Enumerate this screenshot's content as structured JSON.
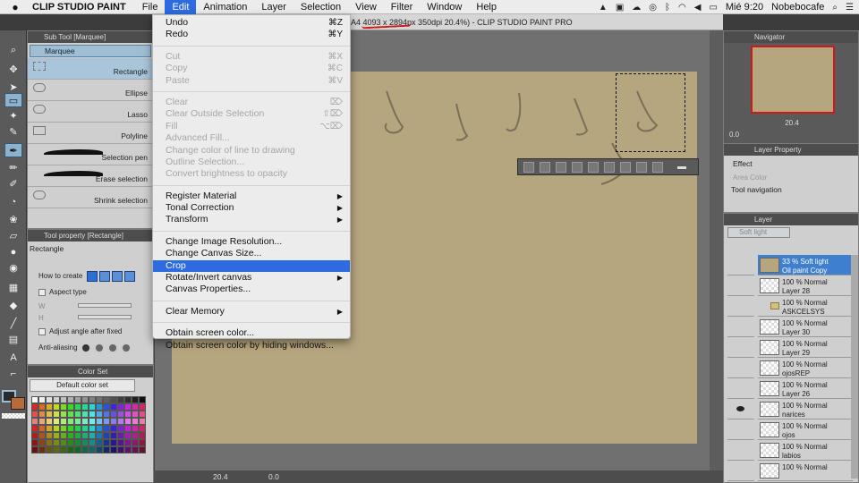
{
  "menubar": {
    "apple": "",
    "app": "CLIP STUDIO PAINT",
    "menus": [
      "File",
      "Edit",
      "Animation",
      "Layer",
      "Selection",
      "View",
      "Filter",
      "Window",
      "Help"
    ],
    "active_menu": "Edit",
    "clock": "Mié 9:20",
    "user": "Nobebocafe"
  },
  "window": {
    "title": "A4 4093 x 2894px 350dpi 20.4%) - CLIP STUDIO PAINT PRO"
  },
  "subtool": {
    "title": "Sub Tool [Marquee]",
    "tab": "Marquee",
    "items": [
      "Rectangle",
      "Ellipse",
      "Lasso",
      "Polyline",
      "Selection pen",
      "Erase selection",
      "Shrink selection"
    ]
  },
  "toolprop": {
    "title": "Tool property [Rectangle]",
    "name": "Rectangle",
    "how_to_create": "How to create",
    "aspect_type": "Aspect type",
    "w": "W",
    "h": "H",
    "adjust_angle": "Adjust angle after fixed",
    "anti_aliasing": "Anti-aliasing"
  },
  "colorset": {
    "title": "Color Set",
    "set_name": "Default color set"
  },
  "edit_menu": [
    {
      "label": "Undo",
      "shortcut": "⌘Z",
      "state": "normal"
    },
    {
      "label": "Redo",
      "shortcut": "⌘Y",
      "state": "normal"
    },
    {
      "sep": true
    },
    {
      "label": "Cut",
      "shortcut": "⌘X",
      "state": "disabled"
    },
    {
      "label": "Copy",
      "shortcut": "⌘C",
      "state": "disabled"
    },
    {
      "label": "Paste",
      "shortcut": "⌘V",
      "state": "disabled"
    },
    {
      "sep": true
    },
    {
      "label": "Clear",
      "shortcut": "⌦",
      "state": "disabled"
    },
    {
      "label": "Clear Outside Selection",
      "shortcut": "⇧⌦",
      "state": "disabled"
    },
    {
      "label": "Fill",
      "shortcut": "⌥⌦",
      "state": "disabled"
    },
    {
      "label": "Advanced Fill...",
      "shortcut": "",
      "state": "disabled"
    },
    {
      "label": "Change color of line to drawing",
      "shortcut": "",
      "state": "disabled"
    },
    {
      "label": "Outline Selection...",
      "shortcut": "",
      "state": "disabled"
    },
    {
      "label": "Convert brightness to opacity",
      "shortcut": "",
      "state": "disabled"
    },
    {
      "sep": true
    },
    {
      "label": "Register Material",
      "shortcut": "▶",
      "state": "normal"
    },
    {
      "label": "Tonal Correction",
      "shortcut": "▶",
      "state": "normal"
    },
    {
      "label": "Transform",
      "shortcut": "▶",
      "state": "normal"
    },
    {
      "sep": true
    },
    {
      "label": "Change Image Resolution...",
      "shortcut": "",
      "state": "normal"
    },
    {
      "label": "Change Canvas Size...",
      "shortcut": "",
      "state": "normal"
    },
    {
      "label": "Crop",
      "shortcut": "",
      "state": "highlighted"
    },
    {
      "label": "Rotate/Invert canvas",
      "shortcut": "▶",
      "state": "normal"
    },
    {
      "label": "Canvas Properties...",
      "shortcut": "",
      "state": "normal"
    },
    {
      "sep": true
    },
    {
      "label": "Clear Memory",
      "shortcut": "▶",
      "state": "normal"
    },
    {
      "sep": true
    },
    {
      "label": "Obtain screen color...",
      "shortcut": "",
      "state": "normal"
    },
    {
      "label": "Obtain screen color by hiding windows...",
      "shortcut": "",
      "state": "normal"
    }
  ],
  "statusbar": {
    "zoom": "20.4",
    "angle": "0.0"
  },
  "navigator": {
    "title": "Navigator",
    "zoom": "20.4",
    "angle": "0.0"
  },
  "layerprop": {
    "title": "Layer Property",
    "effect": "Effect",
    "area_color": "Area Color",
    "tool_navigation": "Tool navigation"
  },
  "layers": {
    "title": "Layer",
    "blend": "Soft light",
    "rows": [
      {
        "line1": "33 % Soft light",
        "line2": "Oil paint Copy",
        "selected": true,
        "folder": false,
        "visible": false
      },
      {
        "line1": "100 % Normal",
        "line2": "Layer 28",
        "selected": false,
        "folder": false,
        "visible": false
      },
      {
        "line1": "100 % Normal",
        "line2": "ASKCELSYS",
        "selected": false,
        "folder": true,
        "visible": false
      },
      {
        "line1": "100 % Normal",
        "line2": "Layer 30",
        "selected": false,
        "folder": false,
        "visible": false
      },
      {
        "line1": "100 % Normal",
        "line2": "Layer 29",
        "selected": false,
        "folder": false,
        "visible": false
      },
      {
        "line1": "100 % Normal",
        "line2": "ojosREP",
        "selected": false,
        "folder": false,
        "visible": false
      },
      {
        "line1": "100 % Normal",
        "line2": "Layer 26",
        "selected": false,
        "folder": false,
        "visible": false
      },
      {
        "line1": "100 % Normal",
        "line2": "narices",
        "selected": false,
        "folder": false,
        "visible": true
      },
      {
        "line1": "100 % Normal",
        "line2": "ojos",
        "selected": false,
        "folder": false,
        "visible": false
      },
      {
        "line1": "100 % Normal",
        "line2": "labios",
        "selected": false,
        "folder": false,
        "visible": false
      },
      {
        "line1": "100 % Normal",
        "line2": "",
        "selected": false,
        "folder": false,
        "visible": false
      }
    ]
  },
  "colors": {
    "canvas": "#b5a67d",
    "accent": "#2d6be0",
    "annotation": "#d01818"
  }
}
